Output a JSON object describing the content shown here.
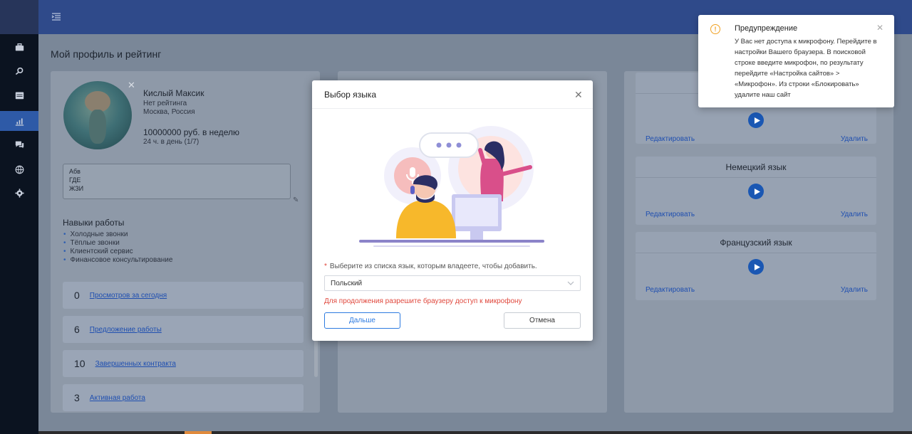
{
  "page": {
    "title": "Мой профиль и рейтинг"
  },
  "profile": {
    "name": "Кислый Максик",
    "rating": "Нет рейтинга",
    "location": "Москва, Россия",
    "price": "10000000 руб. в неделю",
    "hours": "24 ч. в день (1/7)",
    "about_lines": [
      "Абв",
      "ГДЕ",
      "ЖЗИ"
    ],
    "skills_title": "Навыки работы",
    "skills": [
      "Холодные звонки",
      "Тёплые звонки",
      "Клиентский сервис",
      "Финансовое консультирование"
    ],
    "stats": [
      {
        "num": "0",
        "label": "Просмотров за сегодня"
      },
      {
        "num": "6",
        "label": "Предложение работы"
      },
      {
        "num": "10",
        "label": "Завершенных контракта"
      },
      {
        "num": "3",
        "label": "Активная работа"
      }
    ]
  },
  "languages": {
    "edit_label": "Редактировать",
    "delete_label": "Удалить",
    "items": [
      "",
      "Немецкий язык",
      "Французский язык"
    ]
  },
  "modal": {
    "title": "Выбор языка",
    "hint": "Выберите из списка язык, которым владеете, чтобы добавить.",
    "selected": "Польский",
    "error": "Для продолжения разрешите браузеру доступ к микрофону",
    "next_label": "Дальше",
    "cancel_label": "Отмена"
  },
  "notification": {
    "title": "Предупреждение",
    "text": "У Вас нет доступа к микрофону. Перейдите в настройки Вашего браузера. В поисковой строке введите микрофон, по результату перейдите «Настройка сайтов» > «Микрофон». Из строки «Блокировать» удалите наш сайт"
  },
  "colors": {
    "accent": "#2e7be0",
    "error": "#e0483d",
    "warning": "#f0a020",
    "sidebar_active": "#2e5aa7"
  }
}
